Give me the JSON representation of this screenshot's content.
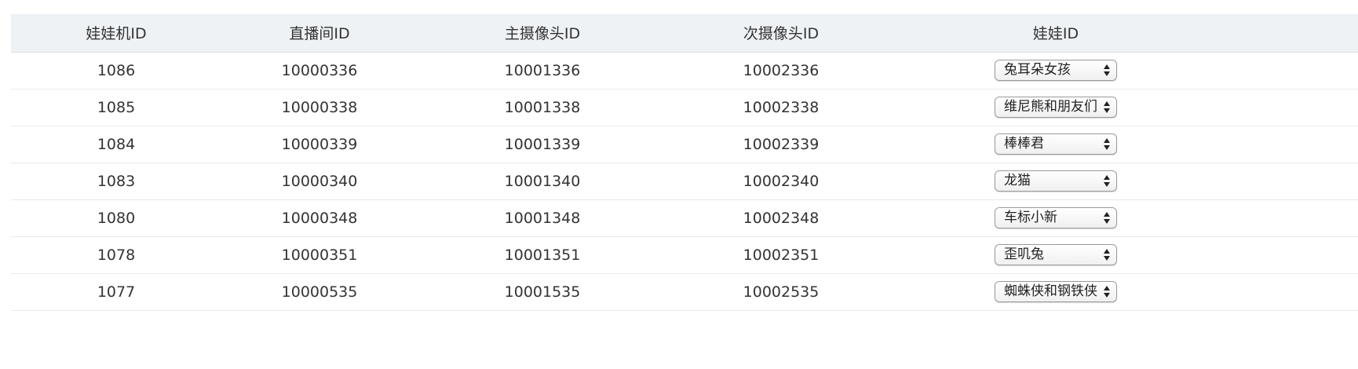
{
  "table": {
    "headers": [
      "娃娃机ID",
      "直播间ID",
      "主摄像头ID",
      "次摄像头ID",
      "娃娃ID"
    ],
    "rows": [
      {
        "machine_id": "1086",
        "room_id": "10000336",
        "main_cam_id": "10001336",
        "sub_cam_id": "10002336",
        "doll": "兔耳朵女孩"
      },
      {
        "machine_id": "1085",
        "room_id": "10000338",
        "main_cam_id": "10001338",
        "sub_cam_id": "10002338",
        "doll": "维尼熊和朋友们"
      },
      {
        "machine_id": "1084",
        "room_id": "10000339",
        "main_cam_id": "10001339",
        "sub_cam_id": "10002339",
        "doll": "棒棒君"
      },
      {
        "machine_id": "1083",
        "room_id": "10000340",
        "main_cam_id": "10001340",
        "sub_cam_id": "10002340",
        "doll": "龙猫"
      },
      {
        "machine_id": "1080",
        "room_id": "10000348",
        "main_cam_id": "10001348",
        "sub_cam_id": "10002348",
        "doll": "车标小新"
      },
      {
        "machine_id": "1078",
        "room_id": "10000351",
        "main_cam_id": "10001351",
        "sub_cam_id": "10002351",
        "doll": "歪叽兔"
      },
      {
        "machine_id": "1077",
        "room_id": "10000535",
        "main_cam_id": "10001535",
        "sub_cam_id": "10002535",
        "doll": "蜘蛛侠和钢铁侠"
      }
    ]
  },
  "icons": {
    "select_arrow": "up-down-arrows-icon"
  },
  "colors": {
    "header_bg": "#eef2f5",
    "row_border": "#e6e9ec",
    "text": "#333333"
  }
}
